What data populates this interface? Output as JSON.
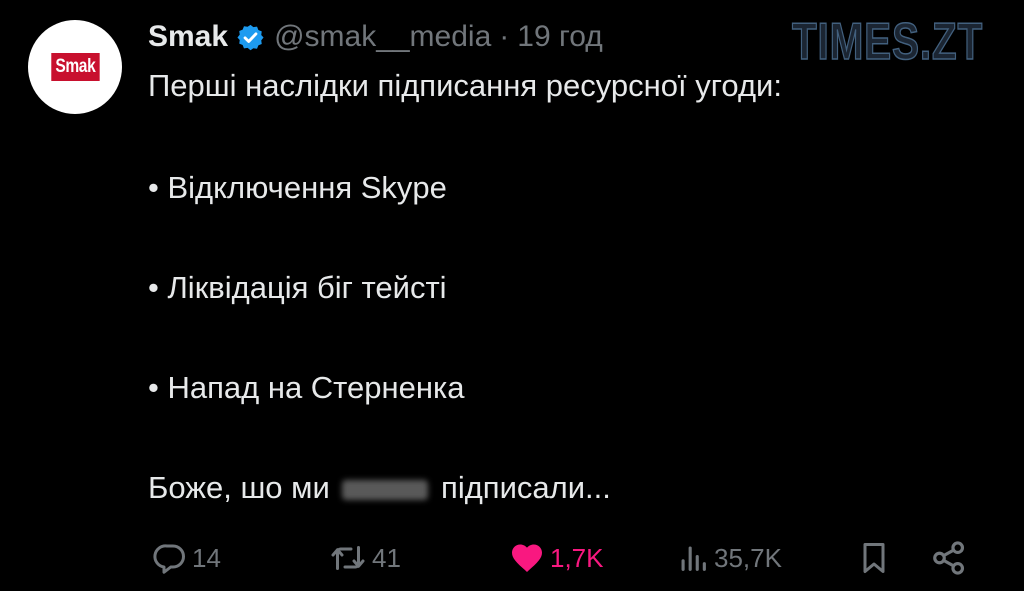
{
  "post": {
    "avatar_text": "Smak",
    "display_name": "Smak",
    "handle": "@smak__media",
    "separator": "·",
    "time": "19 год",
    "lines": {
      "intro": "Перші наслідки підписання ресурсної угоди:",
      "item1": "• Відключення Skype",
      "item2": "• Ліквідація біг тейсті",
      "item3": "• Напад на Стерненка",
      "closing_start": "Боже, шо ми",
      "closing_end": "підписали..."
    }
  },
  "stats": {
    "replies": "14",
    "reposts": "41",
    "likes": "1,7K",
    "views": "35,7K"
  },
  "watermark": "TIMES.ZT",
  "colors": {
    "background": "#000000",
    "text": "#e7e9ea",
    "muted": "#71767b",
    "like": "#f91880",
    "verified": "#1d9bf0",
    "logo_red": "#c8102e"
  },
  "icons": {
    "verified": "verified-badge-icon",
    "reply": "reply-icon",
    "repost": "repost-icon",
    "like": "heart-icon",
    "views": "views-icon",
    "bookmark": "bookmark-icon",
    "share": "share-icon"
  }
}
